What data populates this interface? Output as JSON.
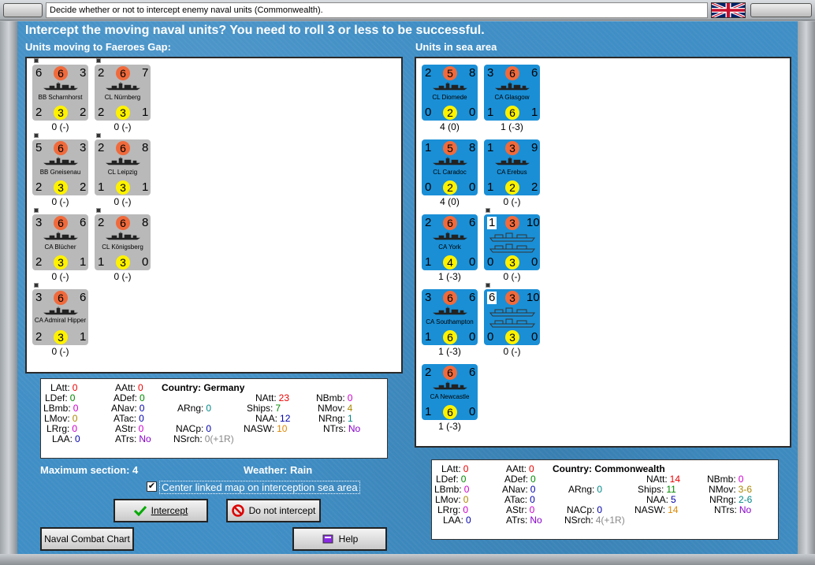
{
  "window": {
    "title": "Decide whether or not to intercept enemy naval units (Commonwealth)."
  },
  "header": {
    "question": "Intercept the moving naval units?  You need to roll 3 or less to be successful."
  },
  "left": {
    "heading": "Units moving to Faeroes Gap:",
    "units": [
      {
        "name": "BB Scharnhorst",
        "tl": "6",
        "tc": "6",
        "tr": "3",
        "bl": "2",
        "bc": "3",
        "br": "2",
        "below": "0 (-)"
      },
      {
        "name": "CL Nürnberg",
        "tl": "2",
        "tc": "6",
        "tr": "7",
        "bl": "2",
        "bc": "3",
        "br": "1",
        "below": "0 (-)"
      },
      {
        "name": "BB Gneisenau",
        "tl": "5",
        "tc": "6",
        "tr": "3",
        "bl": "2",
        "bc": "3",
        "br": "2",
        "below": "0 (-)"
      },
      {
        "name": "CL Leipzig",
        "tl": "2",
        "tc": "6",
        "tr": "8",
        "bl": "1",
        "bc": "3",
        "br": "1",
        "below": "0 (-)"
      },
      {
        "name": "CA Blücher",
        "tl": "3",
        "tc": "6",
        "tr": "6",
        "bl": "2",
        "bc": "3",
        "br": "1",
        "below": "0 (-)"
      },
      {
        "name": "CL Königsberg",
        "tl": "2",
        "tc": "6",
        "tr": "8",
        "bl": "1",
        "bc": "3",
        "br": "0",
        "below": "0 (-)"
      },
      {
        "name": "CA Admiral Hipper",
        "tl": "3",
        "tc": "6",
        "tr": "6",
        "bl": "2",
        "bc": "3",
        "br": "1",
        "below": "0 (-)"
      }
    ]
  },
  "right": {
    "heading": "Units in sea area",
    "units": [
      {
        "name": "CL Diomede",
        "tl": "2",
        "tc": "5",
        "tr": "8",
        "bl": "0",
        "bc": "2",
        "br": "0",
        "below": "4 (0)"
      },
      {
        "name": "CA Glasgow",
        "tl": "3",
        "tc": "6",
        "tr": "6",
        "bl": "1",
        "bc": "6",
        "br": "1",
        "below": "1 (-3)"
      },
      {
        "name": "CL Caradoc",
        "tl": "1",
        "tc": "5",
        "tr": "8",
        "bl": "0",
        "bc": "2",
        "br": "0",
        "below": "4 (0)"
      },
      {
        "name": "CA Erebus",
        "tl": "1",
        "tc": "3",
        "tr": "9",
        "bl": "1",
        "bc": "2",
        "br": "2",
        "below": "0 (-)"
      },
      {
        "name": "CA York",
        "tl": "2",
        "tc": "6",
        "tr": "6",
        "bl": "1",
        "bc": "4",
        "br": "0",
        "below": "1 (-3)"
      },
      {
        "name": "",
        "tl": "1",
        "tc": "3",
        "tr": "10",
        "bl": "0",
        "bc": "3",
        "br": "0",
        "below": "0 (-)"
      },
      {
        "name": "CA Southampton",
        "tl": "3",
        "tc": "6",
        "tr": "6",
        "bl": "1",
        "bc": "6",
        "br": "0",
        "below": "1 (-3)"
      },
      {
        "name": "",
        "tl": "6",
        "tc": "3",
        "tr": "10",
        "bl": "0",
        "bc": "3",
        "br": "0",
        "below": "0 (-)"
      },
      {
        "name": "CA Newcastle",
        "tl": "2",
        "tc": "6",
        "tr": "6",
        "bl": "1",
        "bc": "6",
        "br": "0",
        "below": "1 (-3)"
      }
    ]
  },
  "left_stats": {
    "country_label": "Country:",
    "country": "Germany",
    "LAtt": "0",
    "LDef": "0",
    "LBmb": "0",
    "LMov": "0",
    "LRrg": "0",
    "LAA": "0",
    "AAtt": "0",
    "ADef": "0",
    "ANav": "0",
    "ATac": "0",
    "AStr": "0",
    "ATrs": "No",
    "ARng": "0",
    "NACp": "0",
    "NSrch": "0(+1R)",
    "NAtt": "23",
    "Ships": "7",
    "NAA": "12",
    "NASW": "10",
    "NBmb": "0",
    "NMov": "4",
    "NRng": "1",
    "NTrs": "No"
  },
  "right_stats": {
    "country_label": "Country:",
    "country": "Commonwealth",
    "LAtt": "0",
    "LDef": "0",
    "LBmb": "0",
    "LMov": "0",
    "LRrg": "0",
    "LAA": "0",
    "AAtt": "0",
    "ADef": "0",
    "ANav": "0",
    "ATac": "0",
    "AStr": "0",
    "ATrs": "No",
    "ARng": "0",
    "NACp": "0",
    "NSrch": "4(+1R)",
    "NAtt": "14",
    "Ships": "11",
    "NAA": "5",
    "NASW": "14",
    "NBmb": "0",
    "NMov": "3-6",
    "NRng": "2-6",
    "NTrs": "No"
  },
  "info": {
    "max_section": "Maximum section: 4",
    "weather": "Weather:  Rain"
  },
  "checkbox": {
    "label": "Center linked map on interception sea area",
    "checked": "✔"
  },
  "buttons": {
    "intercept": "Intercept",
    "no_intercept": "Do not intercept",
    "naval_chart": "Naval Combat Chart",
    "help": "Help"
  },
  "colors": {
    "counter_german": "#b9b9b9",
    "counter_commonwealth": "#1a8fd6",
    "attack_circle": "#f06a3c",
    "defense_circle": "#fff200",
    "sea": "#3f8ec5"
  }
}
